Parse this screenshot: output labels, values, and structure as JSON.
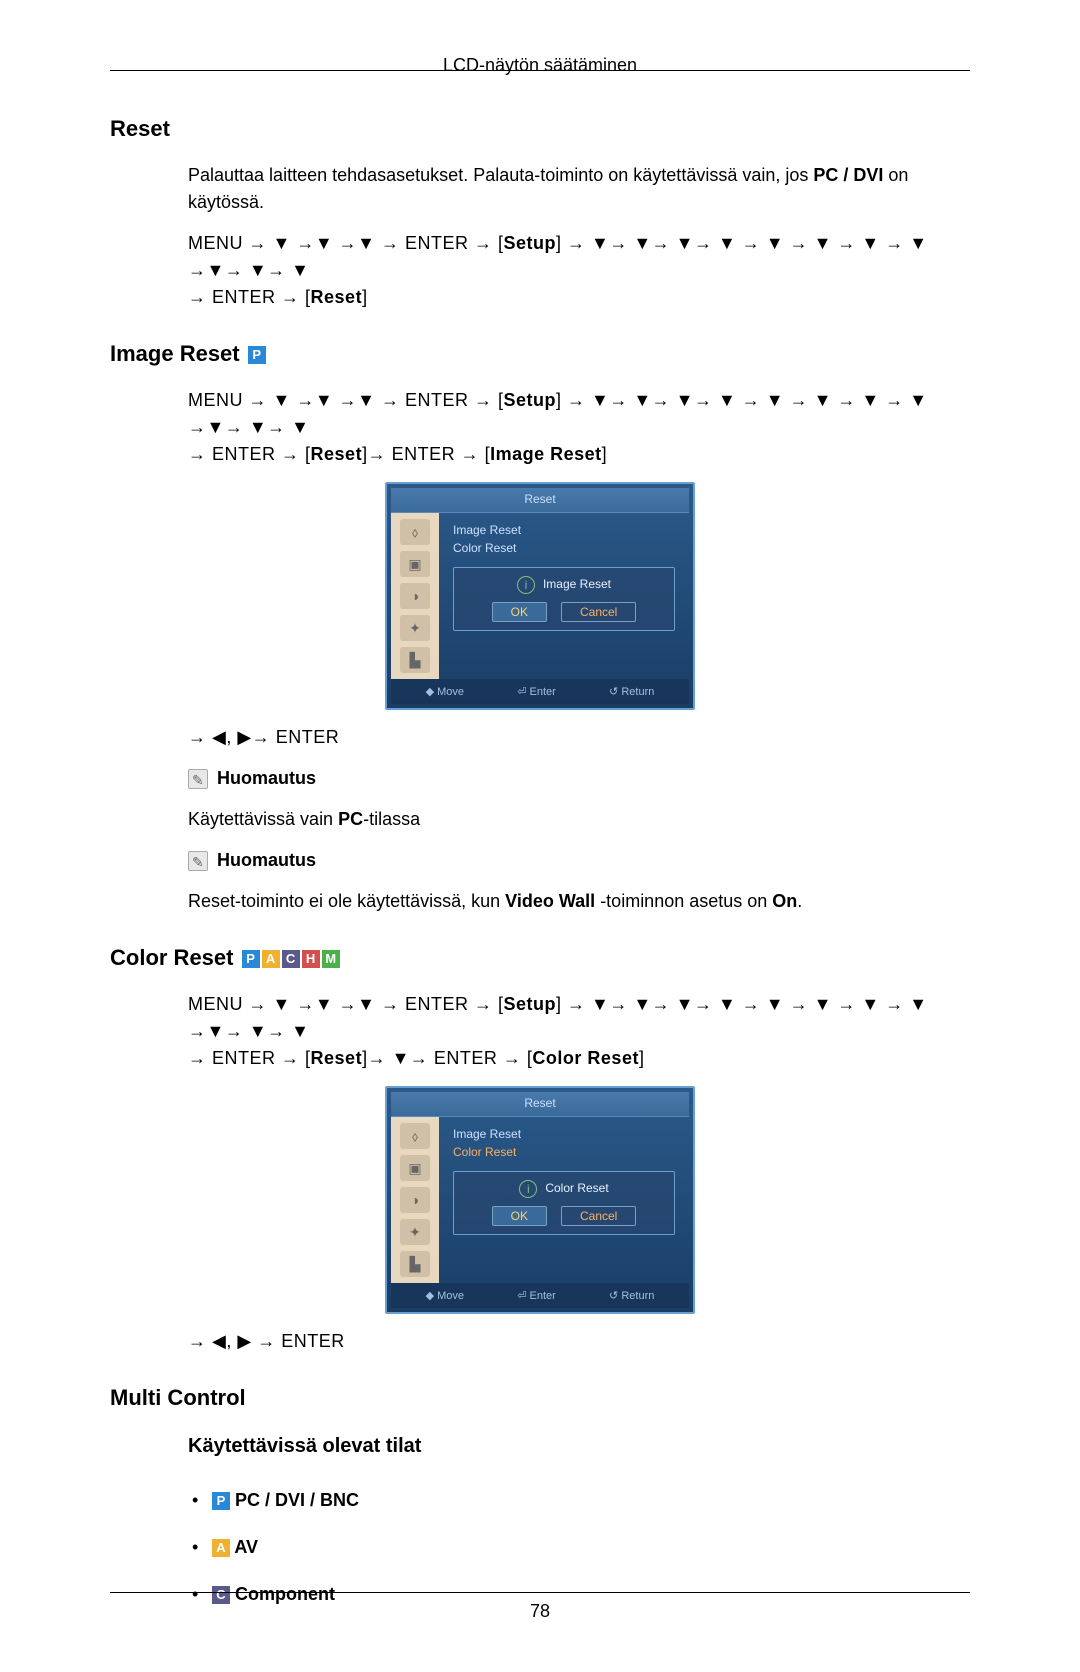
{
  "header": "LCD-näytön säätäminen",
  "footer_page": "78",
  "sections": {
    "reset": {
      "title": "Reset",
      "desc_pre": "Palauttaa laitteen tehdasasetukset. Palauta-toiminto on käytettävissä vain, jos ",
      "desc_bold": "PC / DVI",
      "desc_post": " on käytössä.",
      "nav1": "MENU → ▼ →▼ →▼ → ENTER → ",
      "nav1_setup": "Setup",
      "nav1_cont": " → ▼→ ▼→ ▼→ ▼ → ▼ → ▼ → ▼ → ▼ →▼→ ▼→ ▼",
      "nav2": "→ ENTER → ",
      "nav2_reset": "Reset"
    },
    "image_reset": {
      "title": "Image Reset",
      "nav1": "MENU → ▼ →▼ →▼ → ENTER → ",
      "nav1_setup": "Setup",
      "nav1_cont": " → ▼→ ▼→ ▼→ ▼ → ▼ → ▼ → ▼ → ▼ →▼→ ▼→ ▼",
      "nav2": "→ ENTER → ",
      "nav2_reset": "Reset",
      "nav2_cont": "→ ENTER → ",
      "nav2_image": "Image Reset",
      "osd": {
        "title": "Reset",
        "item1": "Image Reset",
        "item2": "Color Reset",
        "dialog_title": "Image Reset",
        "ok": "OK",
        "cancel": "Cancel",
        "foot_move": "Move",
        "foot_enter": "Enter",
        "foot_return": "Return"
      },
      "nav3": "→ ◀, ▶→ ENTER",
      "note_label": "Huomautus",
      "note1_text_pre": "Käytettävissä vain ",
      "note1_text_bold": "PC",
      "note1_text_post": "-tilassa",
      "note2_label": "Huomautus",
      "note2_text_pre": "Reset-toiminto ei ole käytettävissä, kun ",
      "note2_text_bold": "Video Wall",
      "note2_text_mid": " -toiminnon asetus on ",
      "note2_text_bold2": "On",
      "note2_text_post": "."
    },
    "color_reset": {
      "title": "Color Reset",
      "nav1": "MENU → ▼ →▼ →▼ → ENTER → ",
      "nav1_setup": "Setup",
      "nav1_cont": " → ▼→ ▼→ ▼→ ▼ → ▼ → ▼ → ▼ → ▼ →▼→ ▼→ ▼",
      "nav2": "→ ENTER → ",
      "nav2_reset": "Reset",
      "nav2_cont": "→ ▼→ ENTER → ",
      "nav2_color": "Color Reset",
      "osd": {
        "title": "Reset",
        "item1": "Image Reset",
        "item2": "Color Reset",
        "dialog_title": "Color Reset",
        "ok": "OK",
        "cancel": "Cancel",
        "foot_move": "Move",
        "foot_enter": "Enter",
        "foot_return": "Return"
      },
      "nav3": "→ ◀, ▶ → ENTER"
    },
    "multi_control": {
      "title": "Multi Control",
      "subtitle": "Käytettävissä olevat tilat",
      "items": {
        "pc": "PC / DVI / BNC",
        "av": "AV",
        "component": "Component"
      }
    }
  },
  "mode_labels": {
    "P": "P",
    "A": "A",
    "C": "C",
    "H": "H",
    "M": "M"
  }
}
